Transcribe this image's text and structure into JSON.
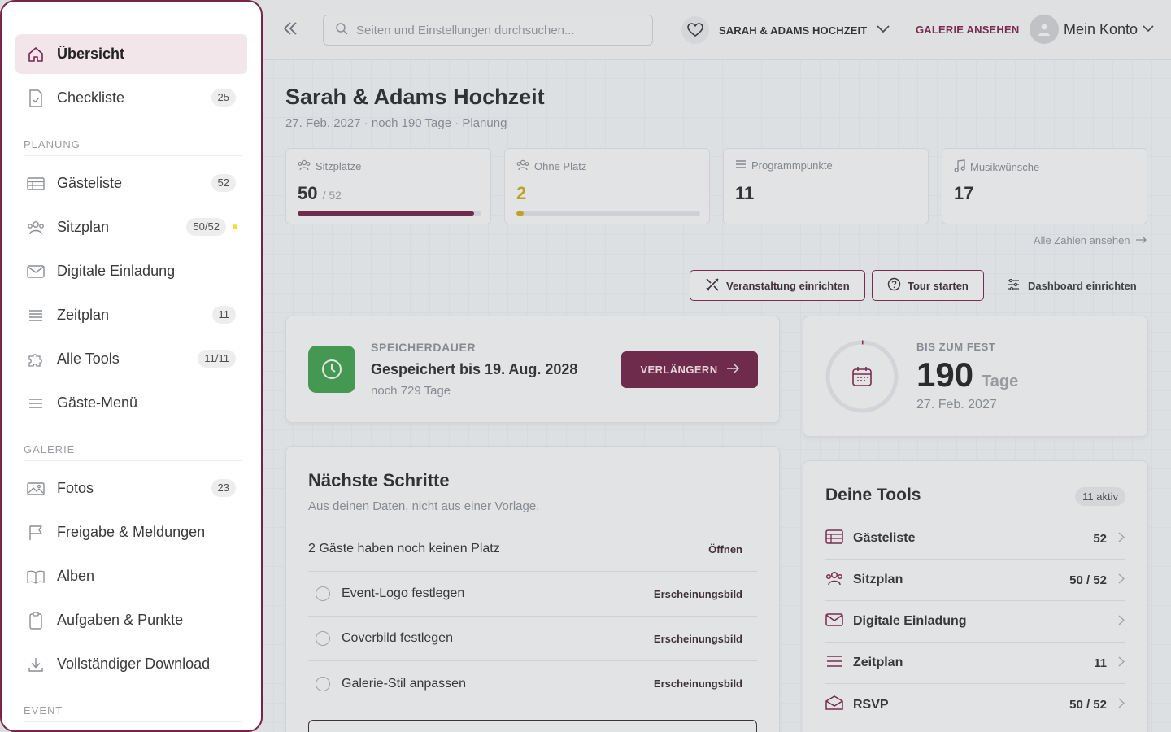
{
  "sidebar": {
    "items_top": [
      {
        "label": "Übersicht",
        "icon": "home-icon",
        "active": true
      },
      {
        "label": "Checkliste",
        "icon": "checklist-icon",
        "badge": "25"
      }
    ],
    "sections": [
      {
        "label": "PLANUNG",
        "items": [
          {
            "label": "Gästeliste",
            "icon": "table-icon",
            "badge": "52"
          },
          {
            "label": "Sitzplan",
            "icon": "people-icon",
            "badge": "50/52",
            "dot": true
          },
          {
            "label": "Digitale Einladung",
            "icon": "mail-icon"
          },
          {
            "label": "Zeitplan",
            "icon": "list-icon",
            "badge": "11"
          },
          {
            "label": "Alle Tools",
            "icon": "puzzle-icon",
            "badge": "11/11"
          },
          {
            "label": "Gäste-Menü",
            "icon": "menu-icon"
          }
        ]
      },
      {
        "label": "GALERIE",
        "items": [
          {
            "label": "Fotos",
            "icon": "image-icon",
            "badge": "23"
          },
          {
            "label": "Freigabe & Meldungen",
            "icon": "flag-icon"
          },
          {
            "label": "Alben",
            "icon": "book-icon"
          },
          {
            "label": "Aufgaben & Punkte",
            "icon": "clipboard-icon"
          },
          {
            "label": "Vollständiger Download",
            "icon": "download-icon"
          }
        ]
      },
      {
        "label": "EVENT",
        "items": []
      }
    ]
  },
  "topbar": {
    "search_placeholder": "Seiten und Einstellungen durchsuchen...",
    "event_name": "SARAH & ADAMS HOCHZEIT",
    "gallery_link": "GALERIE ANSEHEN",
    "account_label": "Mein Konto"
  },
  "header": {
    "title": "Sarah & Adams Hochzeit",
    "subtitle": "27. Feb. 2027 · noch 190 Tage · Planung"
  },
  "stats": [
    {
      "label": "Sitzplätze",
      "value": "50",
      "suffix": "/ 52",
      "progress": 0.96,
      "color": "#6e2244"
    },
    {
      "label": "Ohne Platz",
      "value": "2",
      "progress": 0.04,
      "color": "#c9a51e"
    },
    {
      "label": "Programmpunkte",
      "value": "11"
    },
    {
      "label": "Musikwünsche",
      "value": "17"
    }
  ],
  "links": {
    "all_numbers": "Alle Zahlen ansehen"
  },
  "actions": {
    "setup_event": "Veranstaltung einrichten",
    "start_tour": "Tour starten",
    "setup_dashboard": "Dashboard einrichten"
  },
  "storage": {
    "overline": "SPEICHERDAUER",
    "title": "Gespeichert bis 19. Aug. 2028",
    "sub": "noch 729 Tage",
    "button": "VERLÄNGERN"
  },
  "countdown": {
    "overline": "BIS ZUM FEST",
    "days": "190",
    "unit": "Tage",
    "date": "27. Feb. 2027"
  },
  "next_steps": {
    "title": "Nächste Schritte",
    "subtitle": "Aus deinen Daten, nicht aus einer Vorlage.",
    "rows": [
      {
        "text": "2 Gäste haben noch keinen Platz",
        "action": "Öffnen",
        "checkbox": false
      },
      {
        "text": "Event-Logo festlegen",
        "action": "Erscheinungsbild",
        "checkbox": true
      },
      {
        "text": "Coverbild festlegen",
        "action": "Erscheinungsbild",
        "checkbox": true
      },
      {
        "text": "Galerie-Stil anpassen",
        "action": "Erscheinungsbild",
        "checkbox": true
      }
    ]
  },
  "tools": {
    "title": "Deine Tools",
    "badge": "11 aktiv",
    "rows": [
      {
        "label": "Gästeliste",
        "value": "52",
        "icon": "table-icon"
      },
      {
        "label": "Sitzplan",
        "value": "50 / 52",
        "icon": "people-icon"
      },
      {
        "label": "Digitale Einladung",
        "value": "",
        "icon": "mail-icon"
      },
      {
        "label": "Zeitplan",
        "value": "11",
        "icon": "list-icon"
      },
      {
        "label": "RSVP",
        "value": "50 / 52",
        "icon": "mail-open-icon"
      }
    ]
  },
  "colors": {
    "brand": "#7a2349",
    "success": "#3f9b4c",
    "warning": "#c9a51e"
  }
}
